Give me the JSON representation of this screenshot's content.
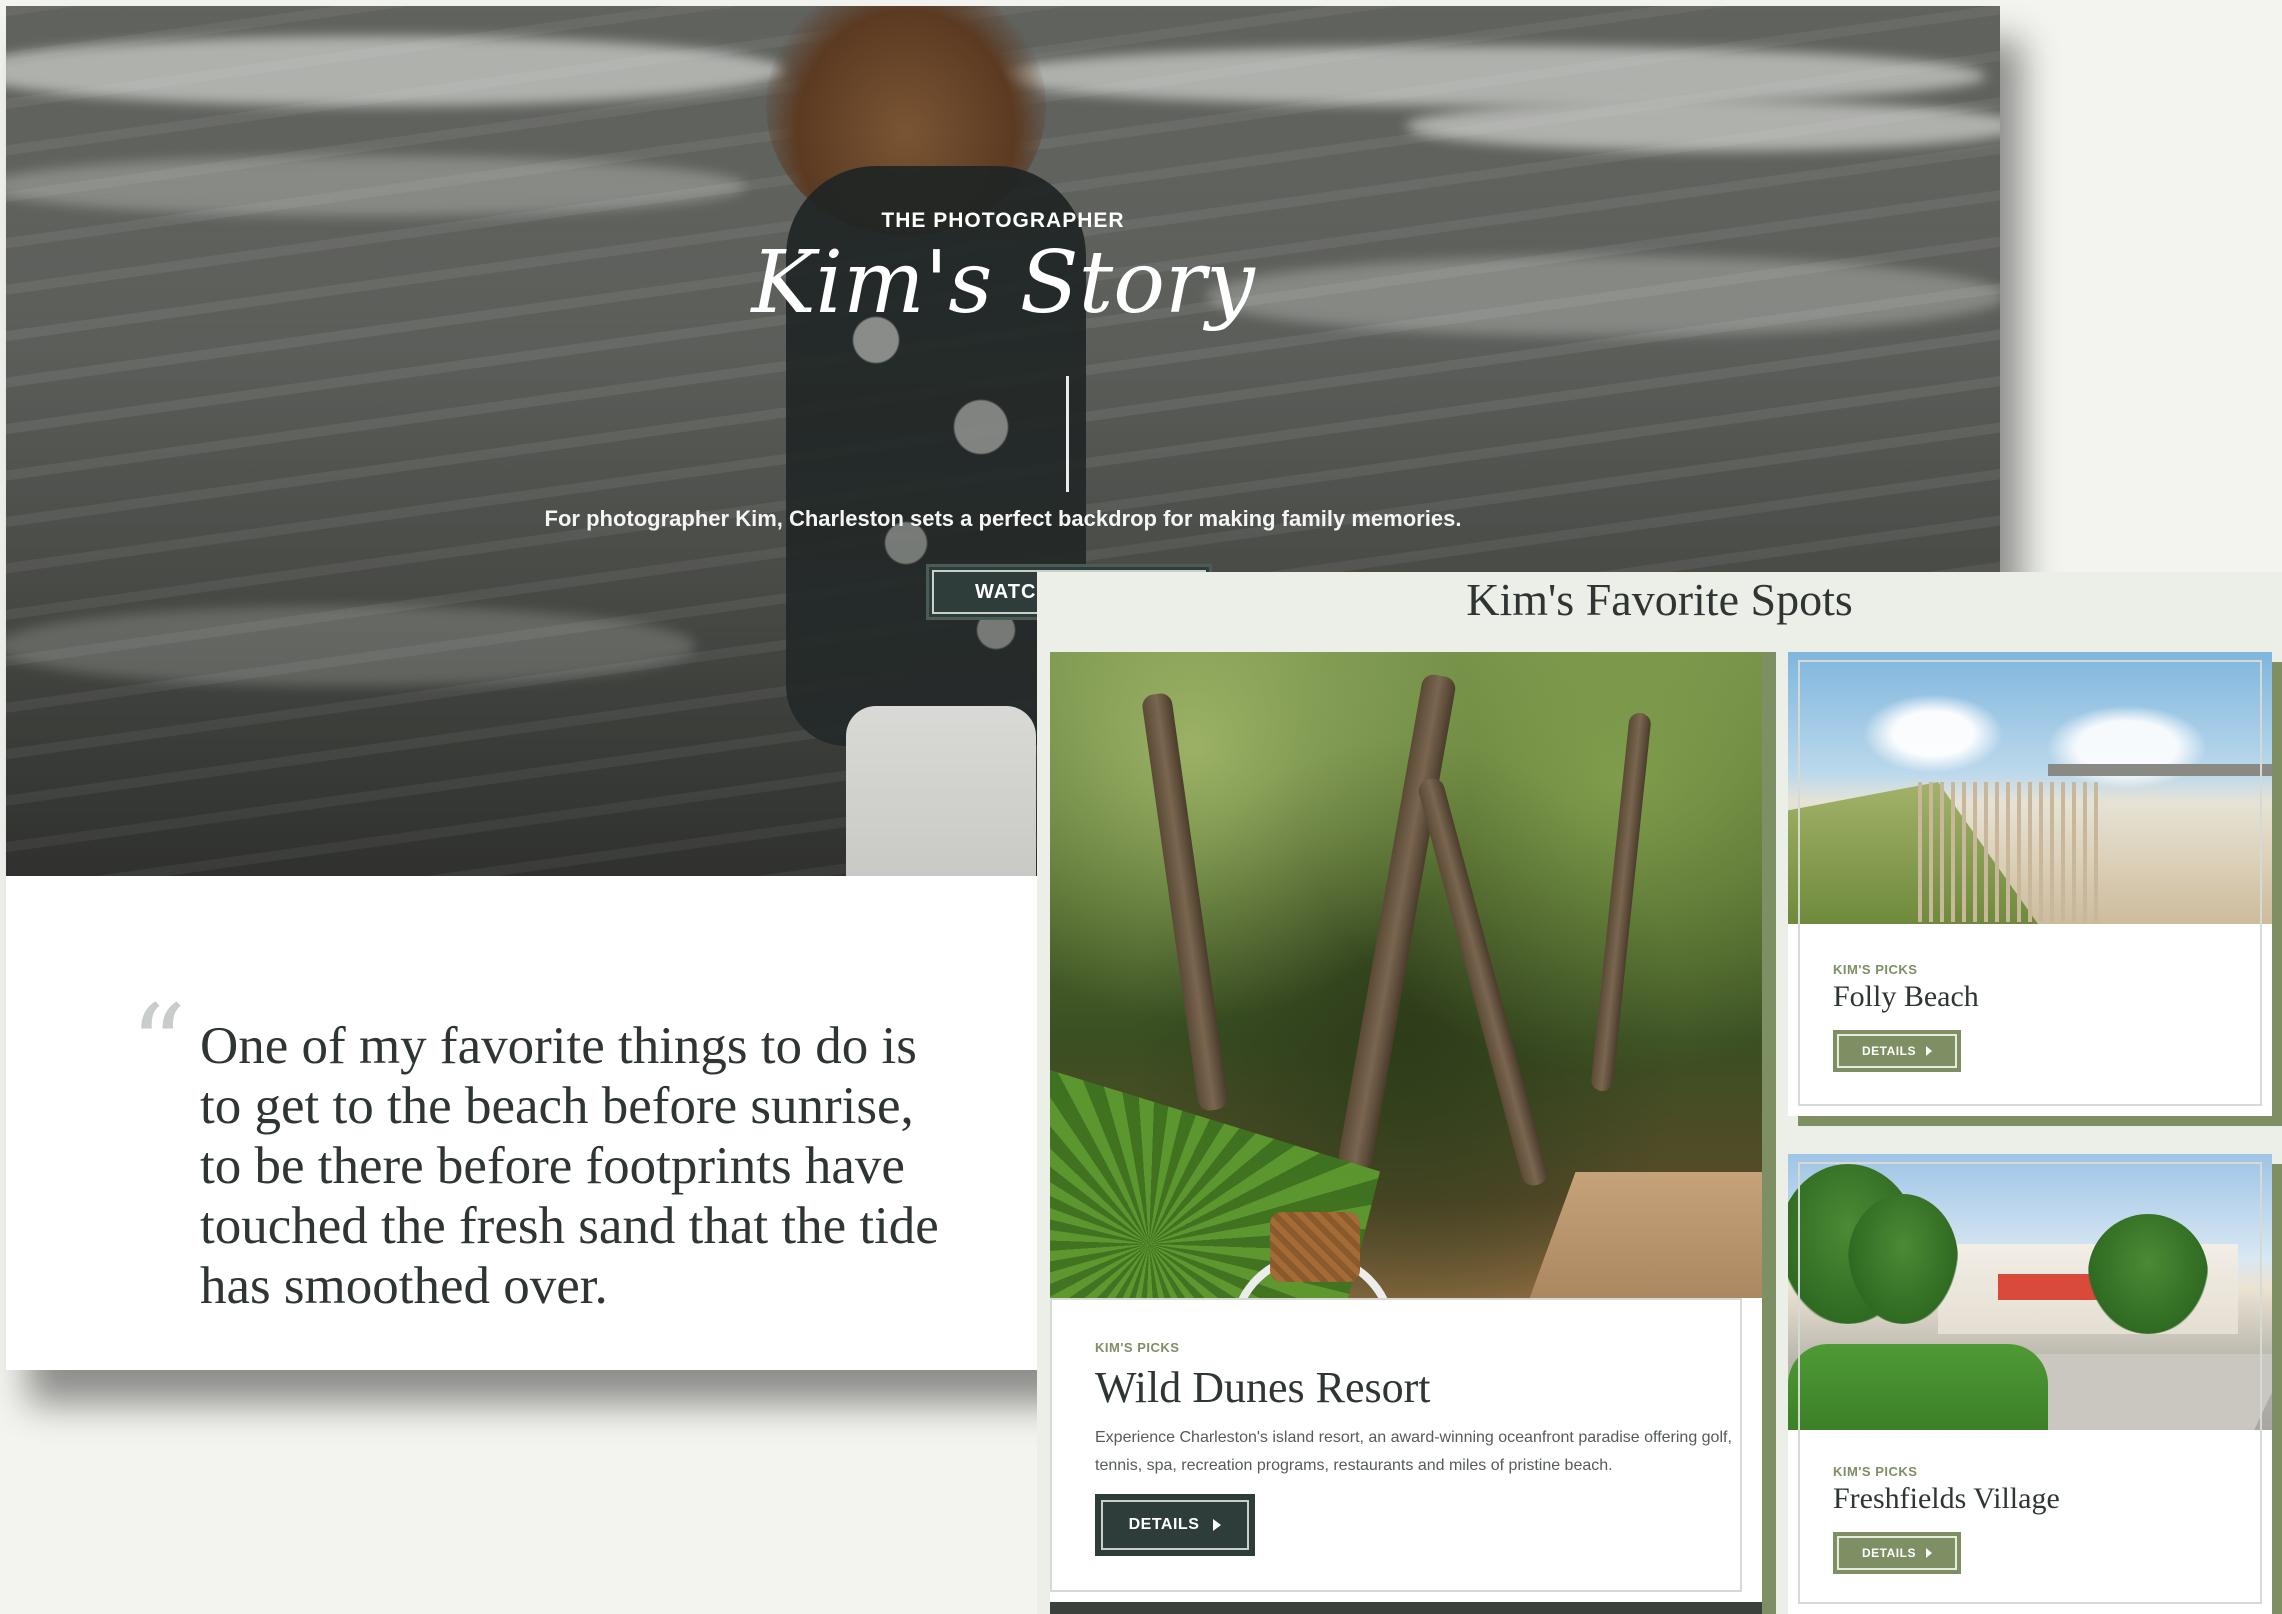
{
  "story": {
    "kicker": "THE PHOTOGRAPHER",
    "title": "Kim's Story",
    "subtitle": "For photographer Kim, Charleston sets a perfect backdrop for making family memories.",
    "watch_label": "WATCH",
    "quote_mark": "“",
    "quote": "One of my favorite things to do is to get to the beach before sunrise, to be there before footprints have touched the fresh sand that the tide has smoothed over."
  },
  "favorites": {
    "title": "Kim's Favorite Spots",
    "featured": {
      "kicker": "KIM'S PICKS",
      "name": "Wild Dunes Resort",
      "description": "Experience Charleston's island resort, an award-winning oceanfront paradise offering golf, tennis, spa, recreation programs, restaurants and miles of pristine beach.",
      "details_label": "DETAILS"
    },
    "cards": [
      {
        "kicker": "KIM'S PICKS",
        "name": "Folly Beach",
        "details_label": "DETAILS"
      },
      {
        "kicker": "KIM'S PICKS",
        "name": "Freshfields Village",
        "details_label": "DETAILS"
      }
    ]
  },
  "colors": {
    "accent_green": "#7d8f63",
    "dark_slate": "#2f3d3a",
    "panel_bg": "#eceee8"
  }
}
